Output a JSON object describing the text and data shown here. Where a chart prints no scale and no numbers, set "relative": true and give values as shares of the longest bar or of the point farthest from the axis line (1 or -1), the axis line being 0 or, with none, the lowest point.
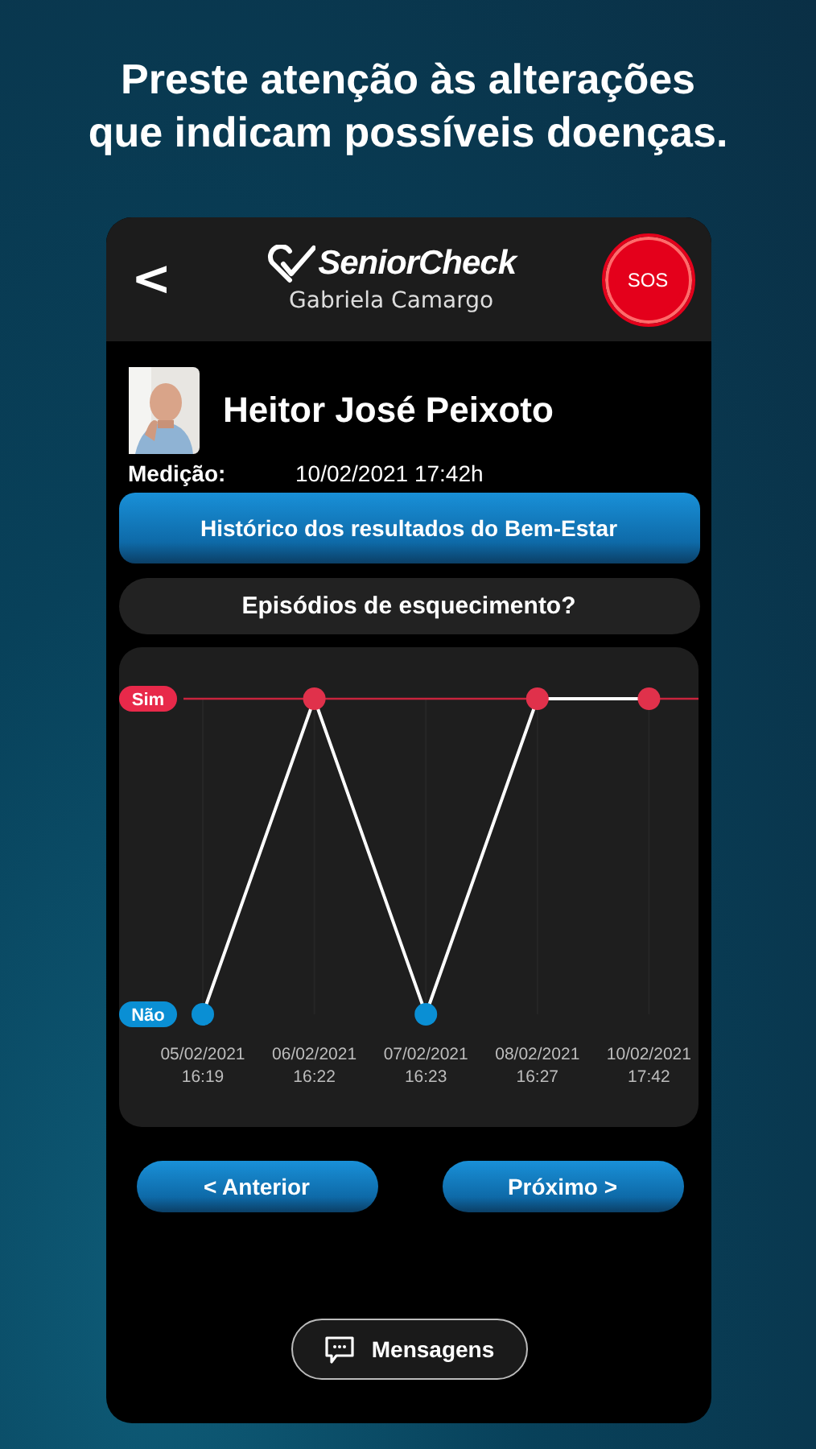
{
  "headline": "Preste atenção às alterações que indicam possíveis doenças.",
  "header": {
    "back": "<",
    "logo": "SeniorCheck",
    "user": "Gabriela Camargo",
    "sos": "SOS"
  },
  "patient": {
    "name": "Heitor José Peixoto",
    "measure_label": "Medição:",
    "measure_value": "10/02/2021 17:42h"
  },
  "history_button": "Histórico dos resultados do Bem-Estar",
  "question": "Episódios de esquecimento?",
  "chart": {
    "chart_data": {
      "type": "line",
      "categories": [
        "05/02/2021 16:19",
        "06/02/2021 16:22",
        "07/02/2021 16:23",
        "08/02/2021 16:27",
        "10/02/2021 17:42"
      ],
      "series": [
        {
          "color": "#ffffff",
          "marker": "circle",
          "values": [
            0,
            1,
            0,
            1,
            1
          ]
        }
      ],
      "relative": true,
      "grid": true,
      "ylim": [
        0,
        1
      ]
    },
    "answer_labels": [
      "Sim",
      "Não"
    ]
  },
  "nav": {
    "previous": "< Anterior",
    "next": "Próximo >"
  },
  "messages_button": "Mensagens"
}
